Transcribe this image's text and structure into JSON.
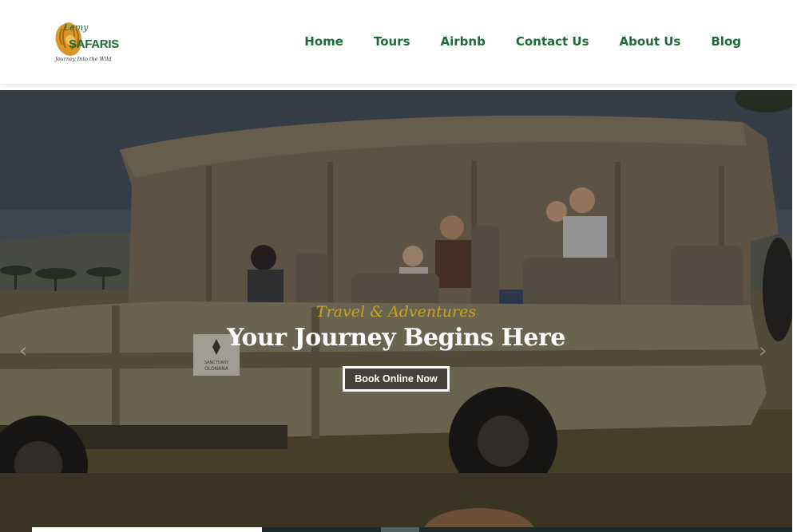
{
  "logo": {
    "text_top": "Lemy",
    "text_main": "SAFARIS",
    "text_sub": "Journey Into the Wild"
  },
  "nav": {
    "items": [
      "Home",
      "Tours",
      "Airbnb",
      "Contact Us",
      "About Us",
      "Blog"
    ]
  },
  "hero": {
    "kicker": "Travel & Adventures",
    "title": "Your Journey Begins Here",
    "button_label": "Book Online Now",
    "prev_arrow": "‹",
    "next_arrow": "›",
    "vehicle_sign": "SANCTUARY OLONANA"
  },
  "colors": {
    "brand_green": "#1e6b3a",
    "gold_accent": "#c9a227",
    "white": "#ffffff"
  }
}
